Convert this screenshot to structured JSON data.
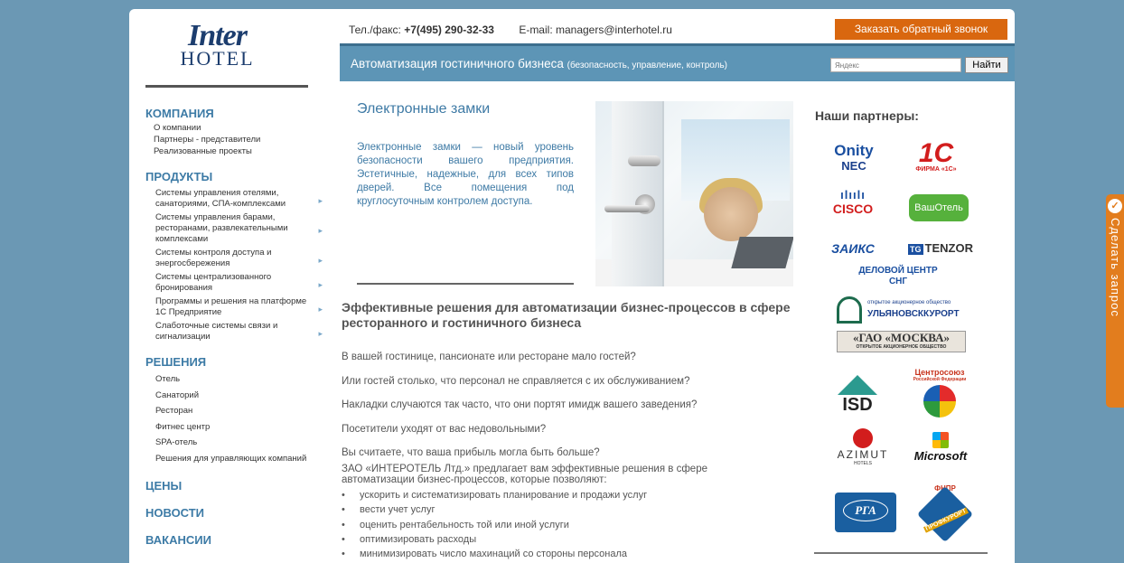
{
  "logo": {
    "line1": "Inter",
    "line2": "HOTEL"
  },
  "sidebar": {
    "company": {
      "title": "КОМПАНИЯ",
      "items": [
        "О компании",
        "Партнеры - представители",
        "Реализованные проекты"
      ]
    },
    "products": {
      "title": "ПРОДУКТЫ",
      "items": [
        "Системы управления отелями, санаториями, СПА-комплексами",
        "Системы управления барами, ресторанами, развлекательными комплексами",
        "Системы контроля доступа и энергосбережения",
        "Системы централизованного бронирования",
        "Программы и решения на платформе 1С Предприятие",
        "Слаботочные системы связи и сигнализации"
      ]
    },
    "solutions": {
      "title": "РЕШЕНИЯ",
      "items": [
        "Отель",
        "Санаторий",
        "Ресторан",
        "Фитнес центр",
        "SPA-отель",
        "Решения для управляющих компаний"
      ]
    },
    "prices": "ЦЕНЫ",
    "news": "НОВОСТИ",
    "vacancies": "ВАКАНСИИ"
  },
  "header": {
    "phone_label": "Тел./факс:",
    "phone": "+7(495) 290-32-33",
    "email": "E-mail: managers@interhotel.ru",
    "callback": "Заказать обратный звонок",
    "tagline": "Автоматизация гостиничного бизнеса",
    "tagline_sub": "(безопасность, управление, контроль)",
    "search_placeholder": "Яндекс",
    "search_button": "Найти"
  },
  "hero": {
    "title": "Электронные замки",
    "text": "Электронные замки — новый уровень безопасности вашего предприятия. Эстетичные, надежные, для всех типов дверей. Все помещения под круглосуточным контролем доступа."
  },
  "article": {
    "title": "Эффективные решения для автоматизации бизнес-процессов в сфере ресторанного и гостиничного бизнеса",
    "questions": [
      "В вашей гостинице, пансионате или ресторане мало гостей?",
      "Или гостей столько, что персонал не справляется с их обслуживанием?",
      "Накладки случаются так часто, что они портят имидж вашего заведения?",
      "Посетители уходят от вас недовольными?",
      "Вы считаете, что ваша прибыль могла быть больше?"
    ],
    "intro": "ЗАО «ИНТЕРОТЕЛЬ Лтд.» предлагает вам эффективные решения в сфере автоматизации бизнес-процессов, которые позволяют:",
    "bullets": [
      "ускорить и систематизировать планирование и продажи услуг",
      "вести учет услуг",
      "оценить рентабельность той или иной услуги",
      "оптимизировать расходы",
      "минимизировать число махинаций со стороны персонала"
    ]
  },
  "partners": {
    "title": "Наши партнеры:",
    "onity": "Onity",
    "nec": "NEC",
    "onec": "1С",
    "onec_sub": "ФИРМА «1С»",
    "cisco": "CISCO",
    "vashotel": "ВашОтель",
    "zaiks": "ЗАИКС",
    "tenzor": "TENZOR",
    "delovoy": "ДЕЛОВОЙ ЦЕНТР СНГ",
    "ulyanovsk": "УЛЬЯНОВСККУРОРТ",
    "ulyanovsk_sub": "открытое акционерное общество",
    "gao": "«ГАО «МОСКВА»",
    "gao_sub": "ОТКРЫТОЕ АКЦИОНЕРНОЕ ОБЩЕСТВО",
    "isd": "ISD",
    "centrosoyuz": "Центросоюз",
    "centrosoyuz_sub": "Российской Федерации",
    "azimut": "AZIMUT",
    "azimut_sub": "HOTELS",
    "microsoft": "Microsoft",
    "rga": "РГА",
    "fnpr": "ФНПР",
    "fnpr_sub": "ПРОФКУРОРТ"
  },
  "side_tab": {
    "label": "Сделать запрос"
  }
}
